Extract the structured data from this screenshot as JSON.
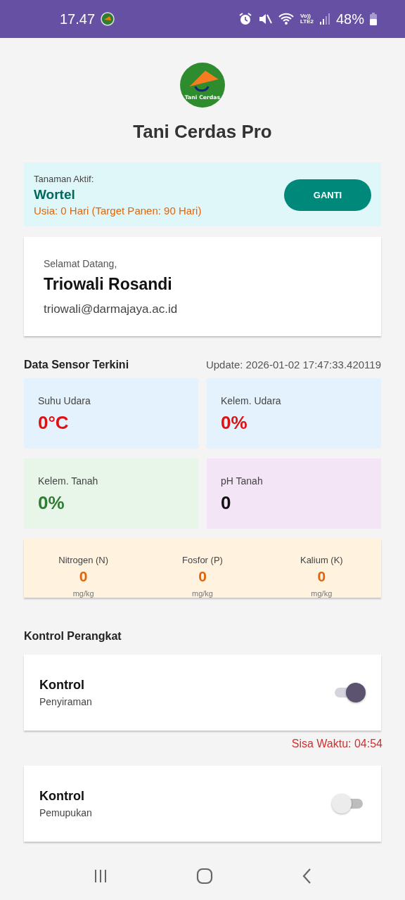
{
  "status_bar": {
    "time": "17.47",
    "network": "Vo))\nLTE2",
    "battery": "48%"
  },
  "app": {
    "logo_text": "Tani Cerdas",
    "title": "Tani Cerdas Pro"
  },
  "active_plant": {
    "label": "Tanaman Aktif:",
    "name": "Wortel",
    "age": "Usia: 0 Hari (Target Panen: 90 Hari)",
    "button": "GANTI"
  },
  "welcome": {
    "greeting": "Selamat Datang,",
    "name": "Triowali Rosandi",
    "email": "triowali@darmajaya.ac.id"
  },
  "sensors": {
    "title": "Data Sensor Terkini",
    "updated": "Update: 2026-01-02 17:47:33.420119",
    "tiles": [
      {
        "label": "Suhu Udara",
        "value": "0°C",
        "color": "#e01010"
      },
      {
        "label": "Kelem. Udara",
        "value": "0%",
        "color": "#e01010"
      },
      {
        "label": "Kelem. Tanah",
        "value": "0%",
        "color": "#2e7d32"
      },
      {
        "label": "pH Tanah",
        "value": "0",
        "color": "#111111"
      }
    ],
    "nutrients": [
      {
        "label": "Nitrogen (N)",
        "value": "0",
        "unit": "mg/kg"
      },
      {
        "label": "Fosfor (P)",
        "value": "0",
        "unit": "mg/kg"
      },
      {
        "label": "Kalium (K)",
        "value": "0",
        "unit": "mg/kg"
      }
    ]
  },
  "controls": {
    "title": "Kontrol Perangkat",
    "items": [
      {
        "title": "Kontrol",
        "subtitle": "Penyiraman",
        "on": true,
        "timer": "Sisa Waktu: 04:54"
      },
      {
        "title": "Kontrol",
        "subtitle": "Pemupukan",
        "on": false
      }
    ]
  }
}
